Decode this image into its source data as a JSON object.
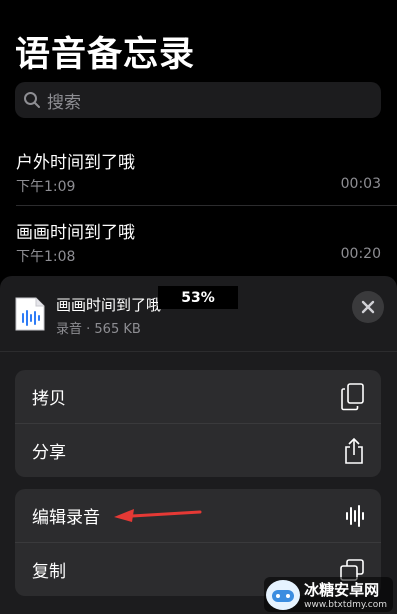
{
  "page_title": "语音备忘录",
  "search": {
    "placeholder": "搜索"
  },
  "recordings": [
    {
      "name": "户外时间到了哦",
      "time": "下午1:09",
      "duration": "00:03"
    },
    {
      "name": "画画时间到了哦",
      "time": "下午1:08",
      "duration": "00:20"
    }
  ],
  "share_sheet": {
    "file_name": "画画时间到了哦",
    "file_meta": "录音 · 565 KB",
    "progress_label": "53%",
    "progress": 53,
    "actions_group1": [
      {
        "label": "拷贝",
        "icon": "copy-icon"
      },
      {
        "label": "分享",
        "icon": "share-icon"
      }
    ],
    "actions_group2": [
      {
        "label": "编辑录音",
        "icon": "waveform-icon"
      },
      {
        "label": "复制",
        "icon": "duplicate-icon"
      }
    ]
  },
  "watermark": {
    "title": "冰糖安卓网",
    "url": "www.btxtdmy.com"
  },
  "colors": {
    "background": "#000000",
    "sheet": "#1c1c1e",
    "cell": "#2c2c2e",
    "secondary_text": "#8e8e93",
    "arrow": "#e53935"
  }
}
